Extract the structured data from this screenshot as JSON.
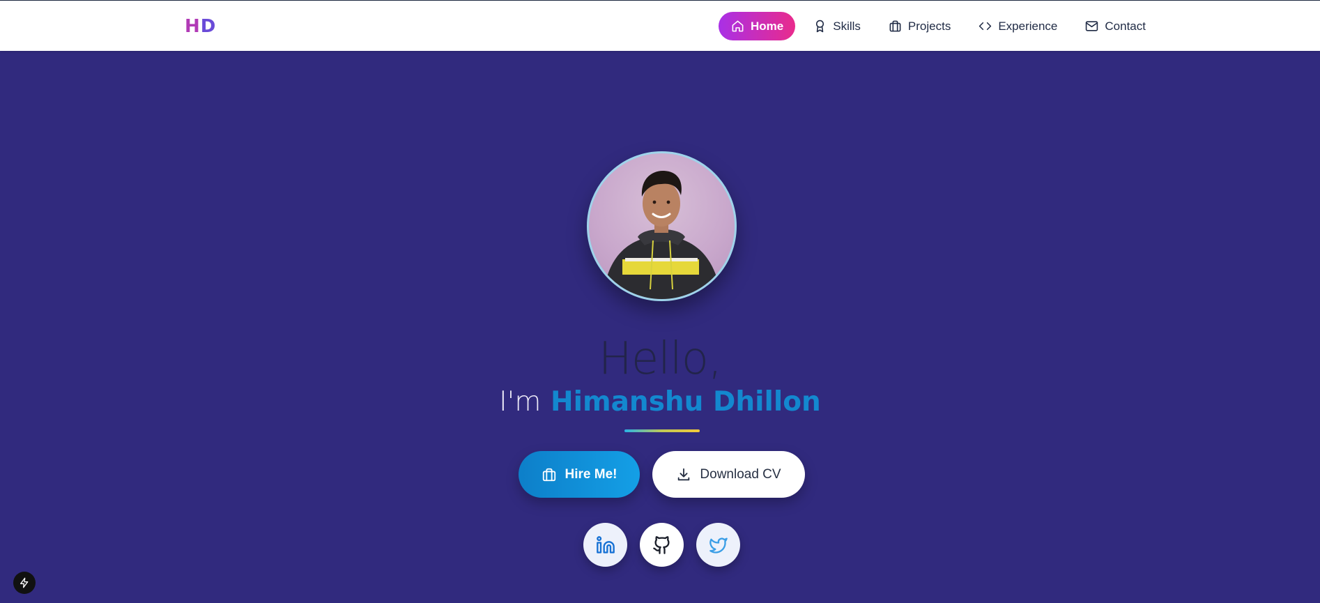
{
  "logo": {
    "first": "H",
    "second": "D"
  },
  "nav": {
    "items": [
      {
        "label": "Home",
        "icon": "home-icon",
        "active": true
      },
      {
        "label": "Skills",
        "icon": "award-icon",
        "active": false
      },
      {
        "label": "Projects",
        "icon": "briefcase-icon",
        "active": false
      },
      {
        "label": "Experience",
        "icon": "code-icon",
        "active": false
      },
      {
        "label": "Contact",
        "icon": "mail-icon",
        "active": false
      }
    ]
  },
  "hero": {
    "avatar_alt": "profile-photo",
    "greeting": "Hello,",
    "intro_prefix": "I'm",
    "name": "Himanshu Dhillon",
    "hire_label": "Hire Me!",
    "cv_label": "Download CV",
    "social": [
      "linkedin-icon",
      "github-icon",
      "twitter-icon"
    ]
  },
  "colors": {
    "background": "#312a7e",
    "nav_active_from": "#a930e6",
    "nav_active_to": "#e92b8c",
    "name": "#1388cf",
    "hire_button": "#0d7fc9"
  }
}
